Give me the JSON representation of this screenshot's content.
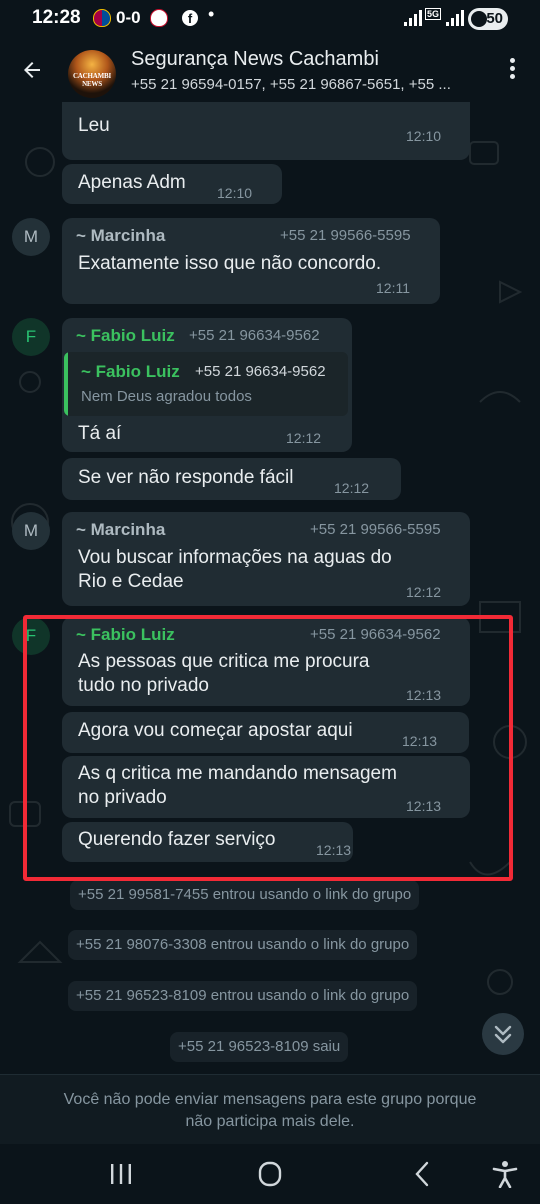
{
  "status_bar": {
    "time": "12:28",
    "score": "0-0",
    "battery": "50"
  },
  "header": {
    "title": "Segurança News Cachambi",
    "members": "+55 21 96594-0157, +55 21 96867-5651, +55 ...",
    "avatar_text": "CACHAMBI NEWS"
  },
  "messages": [
    {
      "text": "Leu",
      "time": "12:10"
    },
    {
      "text": "Apenas Adm",
      "time": "12:10"
    },
    {
      "avatar": "M",
      "sender": "~ Marcinha",
      "phone": "+55 21 99566-5595",
      "text": "Exatamente isso que não concordo.",
      "time": "12:11"
    },
    {
      "avatar": "F",
      "sender": "~ Fabio Luiz",
      "phone": "+55 21 96634-9562",
      "quote": {
        "sender": "~ Fabio Luiz",
        "phone": "+55 21 96634-9562",
        "text": "Nem Deus agradou todos"
      },
      "text": "Tá aí",
      "time": "12:12"
    },
    {
      "text": "Se ver não responde fácil",
      "time": "12:12"
    },
    {
      "avatar": "M",
      "sender": "~ Marcinha",
      "phone": "+55 21 99566-5595",
      "text_lines": [
        "Vou buscar informações na aguas do",
        "Rio e Cedae"
      ],
      "time": "12:12"
    },
    {
      "avatar": "F",
      "sender": "~ Fabio Luiz",
      "phone": "+55 21 96634-9562",
      "text_lines": [
        "As pessoas que critica me procura",
        "tudo no privado"
      ],
      "time": "12:13"
    },
    {
      "text": "Agora vou começar apostar aqui",
      "time": "12:13"
    },
    {
      "text_lines": [
        "As q critica me mandando mensagem",
        "no privado"
      ],
      "time": "12:13"
    },
    {
      "text": "Querendo fazer serviço",
      "time": "12:13"
    }
  ],
  "system_messages": [
    "+55 21 99581-7455 entrou usando o link do grupo",
    "+55 21 98076-3308 entrou usando o link do grupo",
    "+55 21 96523-8109 entrou usando o link do grupo",
    "+55 21 96523-8109 saiu"
  ],
  "footer": {
    "line1": "Você não pode enviar mensagens para este grupo porque",
    "line2": "não participa mais dele."
  },
  "colors": {
    "background": "#0b141a",
    "bubble": "#202c33",
    "sender_green": "#3bc15f",
    "highlight": "#f22a36"
  }
}
